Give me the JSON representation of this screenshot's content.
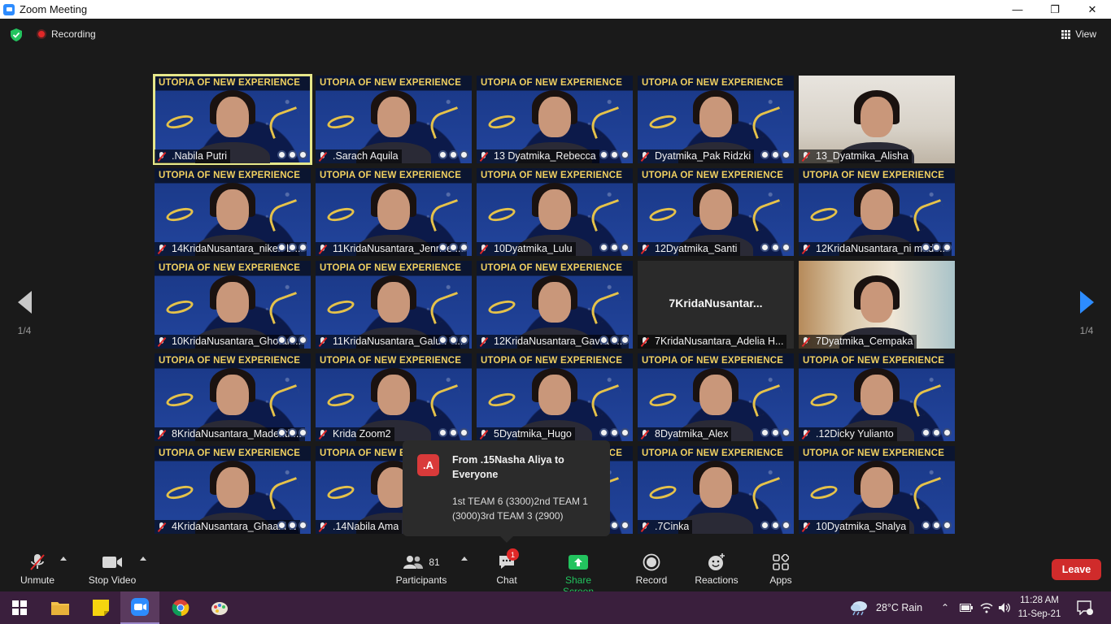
{
  "window": {
    "title": "Zoom Meeting",
    "controls": [
      "—",
      "❐",
      "✕"
    ]
  },
  "topbar": {
    "recording_label": "Recording",
    "view_label": "View"
  },
  "pager": {
    "left_label": "1/4",
    "right_label": "1/4"
  },
  "banner_text": "UTOPIA OF NEW EXPERIENCE",
  "tiles": [
    {
      "name": ".Nabila Putri",
      "bg": "banner",
      "selected": true,
      "mic": "pin"
    },
    {
      "name": ".Sarach Aquila",
      "bg": "banner",
      "mic": "pin"
    },
    {
      "name": "13 Dyatmika_Rebecca",
      "bg": "banner"
    },
    {
      "name": "Dyatmika_Pak Ridzki",
      "bg": "banner"
    },
    {
      "name": "13_Dyatmika_Alisha",
      "bg": "room"
    },
    {
      "name": "14KridaNusantara_niken br...",
      "bg": "banner"
    },
    {
      "name": "11KridaNusantara_Jennifer...",
      "bg": "banner"
    },
    {
      "name": "10Dyatmika_Lulu",
      "bg": "banner"
    },
    {
      "name": "12Dyatmika_Santi",
      "bg": "banner"
    },
    {
      "name": "12KridaNusantara_ni made...",
      "bg": "banner"
    },
    {
      "name": "10KridaNusantara_Ghofari...",
      "bg": "banner"
    },
    {
      "name": "11KridaNusantara_Galuh Ti...",
      "bg": "banner"
    },
    {
      "name": "12KridaNusantara_Gavra T...",
      "bg": "banner"
    },
    {
      "name": "7KridaNusantara_Adelia H...",
      "bg": "plain",
      "center": "7KridaNusantar..."
    },
    {
      "name": "7Dyatmika_Cempaka",
      "bg": "room2"
    },
    {
      "name": "8KridaNusantara_Madenth...",
      "bg": "banner"
    },
    {
      "name": "Krida Zoom2",
      "bg": "banner"
    },
    {
      "name": "5Dyatmika_Hugo",
      "bg": "banner"
    },
    {
      "name": "8Dyatmika_Alex",
      "bg": "banner"
    },
    {
      "name": ".12Dicky Yulianto",
      "bg": "banner"
    },
    {
      "name": "4KridaNusantara_Ghaani N",
      "bg": "banner"
    },
    {
      "name": ".14Nabila Ama",
      "bg": "banner"
    },
    {
      "name": "",
      "bg": "banner"
    },
    {
      "name": ".7Cinka",
      "bg": "banner"
    },
    {
      "name": "10Dyatmika_Shalya",
      "bg": "banner"
    }
  ],
  "chat_popup": {
    "avatar": ".A",
    "from": "From .15Nasha Aliya to Everyone",
    "message": "1st TEAM 6 (3300)2nd TEAM 1 (3000)3rd TEAM 3 (2900)"
  },
  "toolbar": {
    "unmute": "Unmute",
    "stop_video": "Stop Video",
    "participants": "Participants",
    "participants_count": "81",
    "chat": "Chat",
    "chat_badge": "1",
    "share_screen": "Share Screen",
    "record": "Record",
    "reactions": "Reactions",
    "apps": "Apps",
    "leave": "Leave"
  },
  "taskbar": {
    "weather": "28°C  Rain",
    "time": "11:28 AM",
    "date": "11-Sep-21"
  },
  "colors": {
    "accent_blue": "#2d8cff",
    "leave_red": "#d02b2b",
    "share_green": "#22c35e",
    "selected_outline": "#e6e78a"
  }
}
